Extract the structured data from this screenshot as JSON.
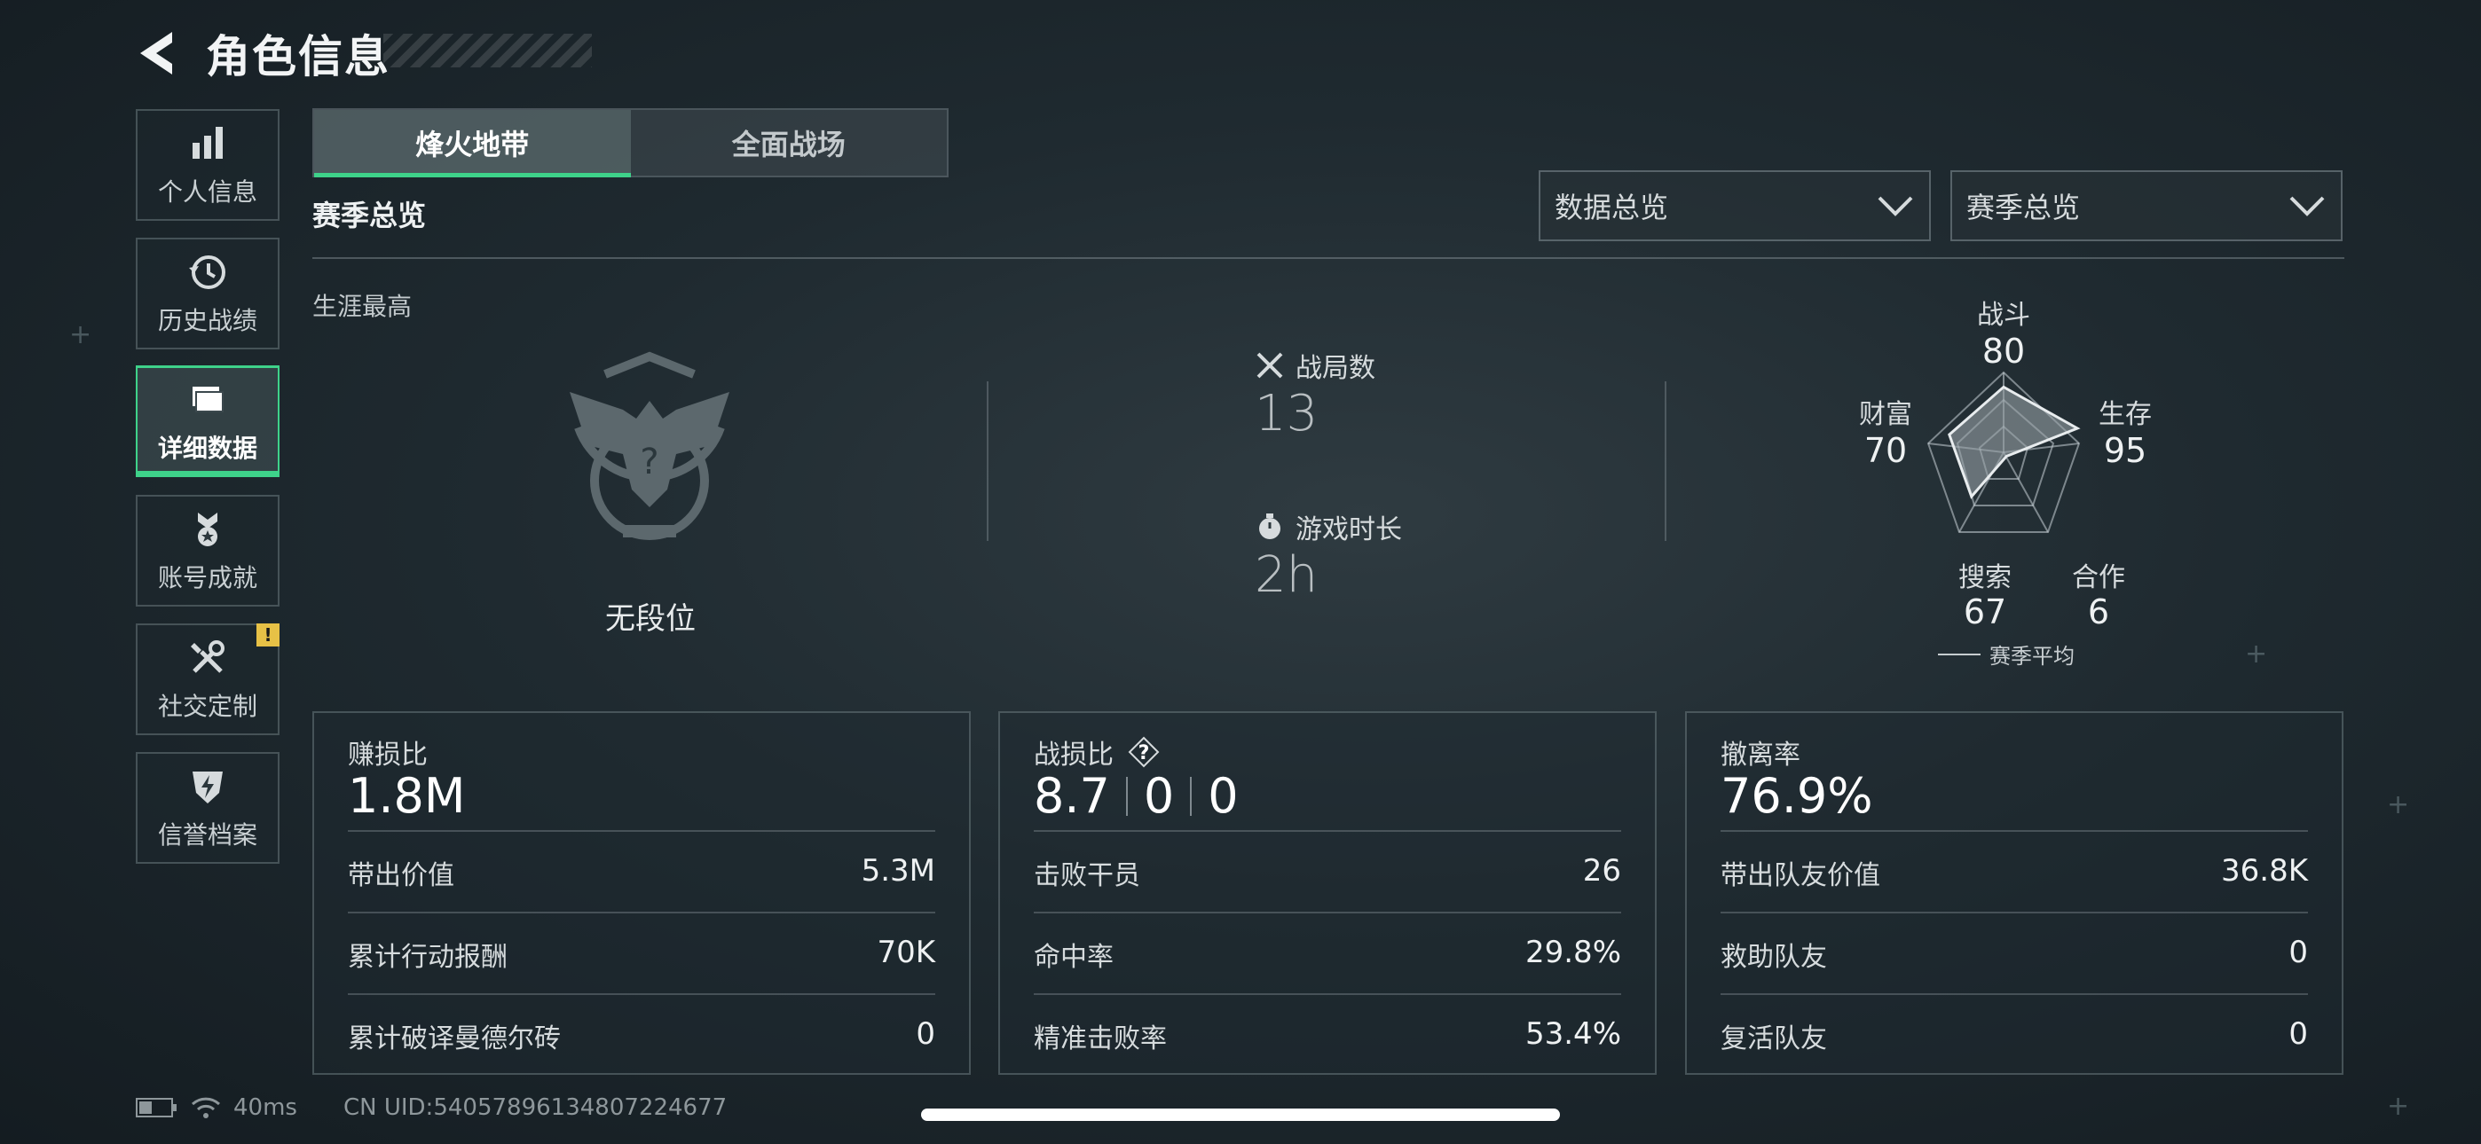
{
  "header": {
    "title": "角色信息"
  },
  "sidebar": {
    "items": [
      {
        "label": "个人信息",
        "icon": "bar-chart-icon",
        "active": false
      },
      {
        "label": "历史战绩",
        "icon": "history-icon",
        "active": false
      },
      {
        "label": "详细数据",
        "icon": "folder-icon",
        "active": true
      },
      {
        "label": "账号成就",
        "icon": "medal-icon",
        "active": false
      },
      {
        "label": "社交定制",
        "icon": "tools-icon",
        "active": false,
        "badge": "!"
      },
      {
        "label": "信誉档案",
        "icon": "shield-bolt-icon",
        "active": false
      }
    ]
  },
  "tabs": [
    {
      "label": "烽火地带",
      "active": true
    },
    {
      "label": "全面战场",
      "active": false
    }
  ],
  "section_title": "赛季总览",
  "dropdowns": {
    "data_scope": {
      "value": "数据总览"
    },
    "season_scope": {
      "value": "赛季总览"
    }
  },
  "career": {
    "label": "生涯最高",
    "rank": "无段位"
  },
  "stats": {
    "matches_label": "战局数",
    "matches_value": "13",
    "playtime_label": "游戏时长",
    "playtime_value": "2h"
  },
  "radar": {
    "axes": [
      {
        "label": "战斗",
        "value": "80"
      },
      {
        "label": "生存",
        "value": "95"
      },
      {
        "label": "合作",
        "value": "6"
      },
      {
        "label": "搜索",
        "value": "67"
      },
      {
        "label": "财富",
        "value": "70"
      }
    ],
    "legend": "赛季平均"
  },
  "cards": {
    "profit": {
      "title": "赚损比",
      "main": "1.8M",
      "rows": [
        {
          "label": "带出价值",
          "value": "5.3M"
        },
        {
          "label": "累计行动报酬",
          "value": "70K"
        },
        {
          "label": "累计破译曼德尔砖",
          "value": "0"
        }
      ]
    },
    "combat": {
      "title": "战损比",
      "main_parts": [
        "8.7",
        "0",
        "0"
      ],
      "help": "?",
      "rows": [
        {
          "label": "击败干员",
          "value": "26"
        },
        {
          "label": "命中率",
          "value": "29.8%"
        },
        {
          "label": "精准击败率",
          "value": "53.4%"
        }
      ]
    },
    "extract": {
      "title": "撤离率",
      "main": "76.9%",
      "rows": [
        {
          "label": "带出队友价值",
          "value": "36.8K"
        },
        {
          "label": "救助队友",
          "value": "0"
        },
        {
          "label": "复活队友",
          "value": "0"
        }
      ]
    }
  },
  "footer": {
    "ping": "40ms",
    "uid": "CN UID:54057896134807224677"
  },
  "colors": {
    "accent": "#3ed28a",
    "badge": "#e7c146"
  }
}
